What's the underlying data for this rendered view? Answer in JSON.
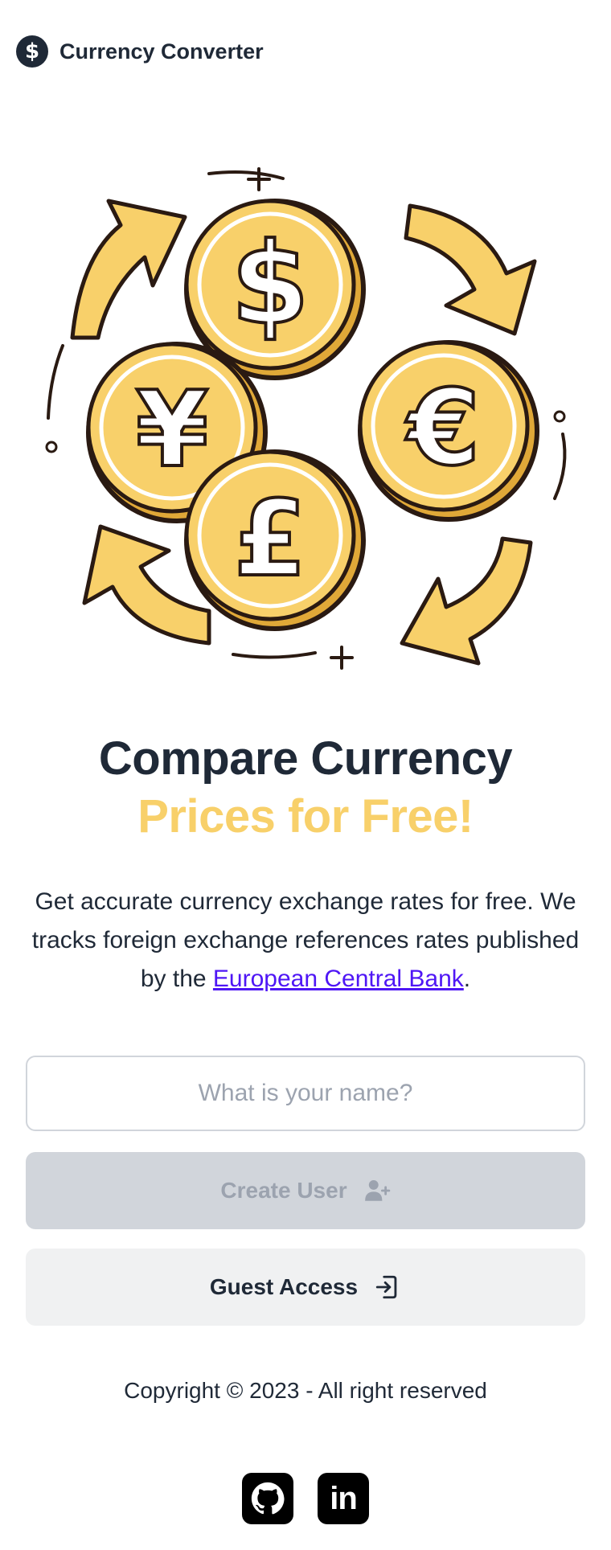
{
  "header": {
    "logo_icon": "dollar-circle-icon",
    "logo_glyph": "$",
    "title": "Currency Converter"
  },
  "hero": {
    "illustration": "currency-exchange-coins-illustration",
    "coin_symbols": {
      "dollar": "$",
      "yen": "¥",
      "euro": "€",
      "pound": "£"
    }
  },
  "headline": {
    "line1": "Compare Currency",
    "line2": "Prices for Free!"
  },
  "description": {
    "text_before_link": "Get accurate currency exchange rates for free. We tracks foreign exchange references rates published by the ",
    "link_text": "European Central Bank",
    "text_after_link": "."
  },
  "form": {
    "name_placeholder": "What is your name?",
    "name_value": "",
    "create_user_label": "Create User",
    "create_user_icon": "user-plus-icon",
    "guest_access_label": "Guest Access",
    "guest_access_icon": "login-icon"
  },
  "footer": {
    "copyright": "Copyright © 2023 - All right reserved",
    "socials": [
      {
        "name": "github",
        "icon": "github-icon"
      },
      {
        "name": "linkedin",
        "icon": "linkedin-icon",
        "glyph": "in"
      }
    ]
  },
  "colors": {
    "accent_yellow": "#f8d06a",
    "text_dark": "#1f2937",
    "link_purple": "#4f16f5",
    "disabled_button": "#d1d5db",
    "guest_button": "#f0f1f2"
  }
}
